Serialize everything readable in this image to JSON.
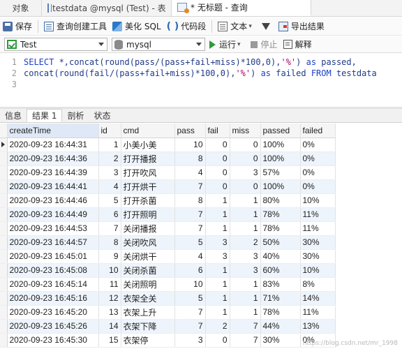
{
  "tabs": [
    {
      "label": "对象",
      "icon": ""
    },
    {
      "label": "testdata @mysql (Test) - 表",
      "icon": "table-icon"
    },
    {
      "label": "* 无标题 - 查询",
      "icon": "query-icon"
    }
  ],
  "toolbar": {
    "save": "保存",
    "query_builder": "查询创建工具",
    "beautify": "美化 SQL",
    "snippet_icon": "( )",
    "snippet": "代码段",
    "text": "文本",
    "export": "导出结果"
  },
  "connection": {
    "conn_name": "Test",
    "database": "mysql",
    "run": "运行",
    "stop": "停止",
    "explain": "解释"
  },
  "editor": {
    "lines": [
      {
        "num": "1",
        "parts": [
          {
            "t": "SELECT",
            "c": "kw"
          },
          {
            "t": " *,concat(round(pass/(pass+fail+miss)*100,0),",
            "c": "txt"
          },
          {
            "t": "'%'",
            "c": "str"
          },
          {
            "t": ") ",
            "c": "txt"
          },
          {
            "t": "as",
            "c": "kw"
          },
          {
            "t": " passed,",
            "c": "txt"
          }
        ]
      },
      {
        "num": "2",
        "parts": [
          {
            "t": "concat(round(fail/(pass+fail+miss)*100,0),",
            "c": "txt"
          },
          {
            "t": "'%'",
            "c": "str"
          },
          {
            "t": ") ",
            "c": "txt"
          },
          {
            "t": "as",
            "c": "kw"
          },
          {
            "t": " failed ",
            "c": "txt"
          },
          {
            "t": "FROM",
            "c": "kw"
          },
          {
            "t": " testdata",
            "c": "txt"
          }
        ]
      },
      {
        "num": "3",
        "parts": []
      }
    ]
  },
  "result_tabs": [
    "信息",
    "结果 1",
    "剖析",
    "状态"
  ],
  "result_active_tab": 1,
  "grid": {
    "columns": [
      "createTime",
      "id",
      "cmd",
      "pass",
      "fail",
      "miss",
      "passed",
      "failed"
    ],
    "rows": [
      [
        "2020-09-23 16:44:31",
        "1",
        "小美小美",
        "10",
        "0",
        "0",
        "100%",
        "0%"
      ],
      [
        "2020-09-23 16:44:36",
        "2",
        "打开播报",
        "8",
        "0",
        "0",
        "100%",
        "0%"
      ],
      [
        "2020-09-23 16:44:39",
        "3",
        "打开吹风",
        "4",
        "0",
        "3",
        "57%",
        "0%"
      ],
      [
        "2020-09-23 16:44:41",
        "4",
        "打开烘干",
        "7",
        "0",
        "0",
        "100%",
        "0%"
      ],
      [
        "2020-09-23 16:44:46",
        "5",
        "打开杀菌",
        "8",
        "1",
        "1",
        "80%",
        "10%"
      ],
      [
        "2020-09-23 16:44:49",
        "6",
        "打开照明",
        "7",
        "1",
        "1",
        "78%",
        "11%"
      ],
      [
        "2020-09-23 16:44:53",
        "7",
        "关闭播报",
        "7",
        "1",
        "1",
        "78%",
        "11%"
      ],
      [
        "2020-09-23 16:44:57",
        "8",
        "关闭吹风",
        "5",
        "3",
        "2",
        "50%",
        "30%"
      ],
      [
        "2020-09-23 16:45:01",
        "9",
        "关闭烘干",
        "4",
        "3",
        "3",
        "40%",
        "30%"
      ],
      [
        "2020-09-23 16:45:08",
        "10",
        "关闭杀菌",
        "6",
        "1",
        "3",
        "60%",
        "10%"
      ],
      [
        "2020-09-23 16:45:14",
        "11",
        "关闭照明",
        "10",
        "1",
        "1",
        "83%",
        "8%"
      ],
      [
        "2020-09-23 16:45:16",
        "12",
        "衣架全关",
        "5",
        "1",
        "1",
        "71%",
        "14%"
      ],
      [
        "2020-09-23 16:45:20",
        "13",
        "衣架上升",
        "7",
        "1",
        "1",
        "78%",
        "11%"
      ],
      [
        "2020-09-23 16:45:26",
        "14",
        "衣架下降",
        "7",
        "2",
        "7",
        "44%",
        "13%"
      ],
      [
        "2020-09-23 16:45:30",
        "15",
        "衣架停",
        "3",
        "0",
        "7",
        "30%",
        "0%"
      ]
    ]
  },
  "watermark": "https://blog.csdn.net/mr_1998"
}
